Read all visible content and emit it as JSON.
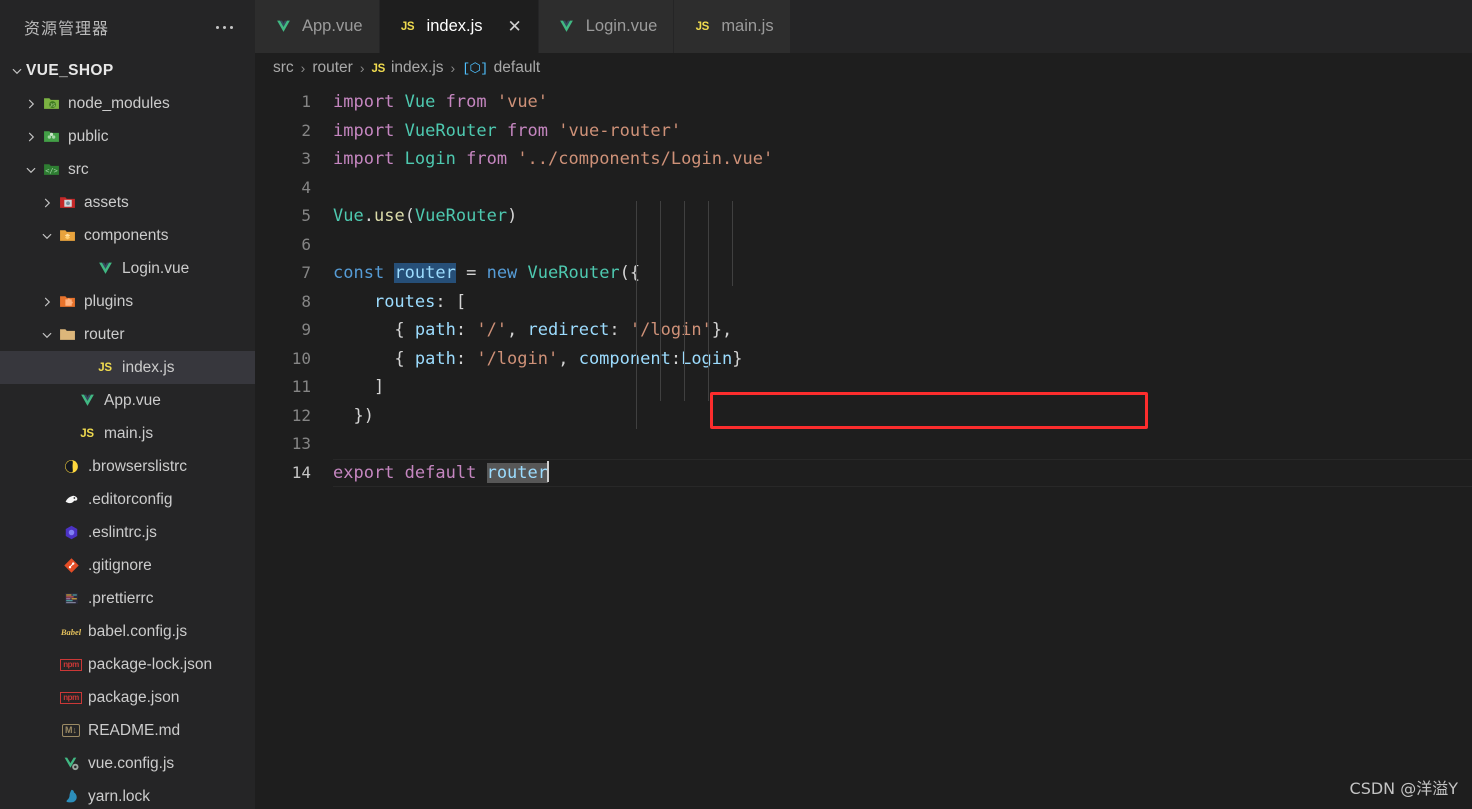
{
  "sidebar": {
    "title": "资源管理器",
    "more_actions": "...",
    "root": {
      "label": "VUE_SHOP",
      "expanded": true
    },
    "items": [
      {
        "label": "node_modules",
        "icon": "nodejs-folder-icon",
        "kind": "folder",
        "indent": 1,
        "twisty": "collapsed"
      },
      {
        "label": "public",
        "icon": "public-folder-icon",
        "kind": "folder",
        "indent": 1,
        "twisty": "collapsed"
      },
      {
        "label": "src",
        "icon": "src-folder-icon",
        "kind": "folder",
        "indent": 1,
        "twisty": "expanded"
      },
      {
        "label": "assets",
        "icon": "assets-folder-icon",
        "kind": "folder",
        "indent": 2,
        "twisty": "collapsed"
      },
      {
        "label": "components",
        "icon": "components-folder-icon",
        "kind": "folder",
        "indent": 2,
        "twisty": "expanded"
      },
      {
        "label": "Login.vue",
        "icon": "vue-icon",
        "kind": "file",
        "indent": 3,
        "twisty": "none"
      },
      {
        "label": "plugins",
        "icon": "plugins-folder-icon",
        "kind": "folder",
        "indent": 2,
        "twisty": "collapsed"
      },
      {
        "label": "router",
        "icon": "router-folder-icon",
        "kind": "folder",
        "indent": 2,
        "twisty": "expanded"
      },
      {
        "label": "index.js",
        "icon": "js-icon",
        "kind": "file",
        "indent": 3,
        "twisty": "none",
        "selected": true
      },
      {
        "label": "App.vue",
        "icon": "vue-icon",
        "kind": "file",
        "indent": 2,
        "twisty": "none"
      },
      {
        "label": "main.js",
        "icon": "js-icon",
        "kind": "file",
        "indent": 2,
        "twisty": "none"
      },
      {
        "label": ".browserslistrc",
        "icon": "browserslist-icon",
        "kind": "file",
        "indent": 1,
        "twisty": "none"
      },
      {
        "label": ".editorconfig",
        "icon": "editorconfig-icon",
        "kind": "file",
        "indent": 1,
        "twisty": "none"
      },
      {
        "label": ".eslintrc.js",
        "icon": "eslint-icon",
        "kind": "file",
        "indent": 1,
        "twisty": "none"
      },
      {
        "label": ".gitignore",
        "icon": "git-icon",
        "kind": "file",
        "indent": 1,
        "twisty": "none"
      },
      {
        "label": ".prettierrc",
        "icon": "prettier-icon",
        "kind": "file",
        "indent": 1,
        "twisty": "none"
      },
      {
        "label": "babel.config.js",
        "icon": "babel-icon",
        "kind": "file",
        "indent": 1,
        "twisty": "none"
      },
      {
        "label": "package-lock.json",
        "icon": "npm-icon",
        "kind": "file",
        "indent": 1,
        "twisty": "none"
      },
      {
        "label": "package.json",
        "icon": "npm-icon",
        "kind": "file",
        "indent": 1,
        "twisty": "none"
      },
      {
        "label": "README.md",
        "icon": "markdown-icon",
        "kind": "file",
        "indent": 1,
        "twisty": "none"
      },
      {
        "label": "vue.config.js",
        "icon": "vue-config-icon",
        "kind": "file",
        "indent": 1,
        "twisty": "none"
      },
      {
        "label": "yarn.lock",
        "icon": "yarn-icon",
        "kind": "file",
        "indent": 1,
        "twisty": "none"
      }
    ]
  },
  "tabs": [
    {
      "label": "App.vue",
      "icon": "vue-icon",
      "active": false,
      "closable": false
    },
    {
      "label": "index.js",
      "icon": "js-icon",
      "active": true,
      "closable": true,
      "close_glyph": "✕"
    },
    {
      "label": "Login.vue",
      "icon": "vue-icon",
      "active": false,
      "closable": false
    },
    {
      "label": "main.js",
      "icon": "js-icon",
      "active": false,
      "closable": false
    }
  ],
  "breadcrumb": [
    {
      "label": "src",
      "icon": null
    },
    {
      "label": "router",
      "icon": null
    },
    {
      "label": "index.js",
      "icon": "js-badge"
    },
    {
      "label": "default",
      "icon": "symbol-object-icon"
    }
  ],
  "breadcrumb_separator": "›",
  "editor": {
    "filename": "index.js",
    "language": "javascript",
    "active_line": 14,
    "cursor_line": 14,
    "lines": [
      {
        "n": 1,
        "tokens": [
          {
            "t": "import",
            "c": "kw"
          },
          {
            "t": " ",
            "c": "pln"
          },
          {
            "t": "Vue",
            "c": "id"
          },
          {
            "t": " ",
            "c": "pln"
          },
          {
            "t": "from",
            "c": "kw"
          },
          {
            "t": " ",
            "c": "pln"
          },
          {
            "t": "'vue'",
            "c": "str"
          }
        ]
      },
      {
        "n": 2,
        "tokens": [
          {
            "t": "import",
            "c": "kw"
          },
          {
            "t": " ",
            "c": "pln"
          },
          {
            "t": "VueRouter",
            "c": "id"
          },
          {
            "t": " ",
            "c": "pln"
          },
          {
            "t": "from",
            "c": "kw"
          },
          {
            "t": " ",
            "c": "pln"
          },
          {
            "t": "'vue-router'",
            "c": "str"
          }
        ]
      },
      {
        "n": 3,
        "tokens": [
          {
            "t": "import",
            "c": "kw"
          },
          {
            "t": " ",
            "c": "pln"
          },
          {
            "t": "Login",
            "c": "id"
          },
          {
            "t": " ",
            "c": "pln"
          },
          {
            "t": "from",
            "c": "kw"
          },
          {
            "t": " ",
            "c": "pln"
          },
          {
            "t": "'../components/Login.vue'",
            "c": "str"
          }
        ]
      },
      {
        "n": 4,
        "tokens": []
      },
      {
        "n": 5,
        "tokens": [
          {
            "t": "Vue",
            "c": "id"
          },
          {
            "t": ".",
            "c": "pln"
          },
          {
            "t": "use",
            "c": "fn"
          },
          {
            "t": "(",
            "c": "pln"
          },
          {
            "t": "VueRouter",
            "c": "id"
          },
          {
            "t": ")",
            "c": "pln"
          }
        ]
      },
      {
        "n": 6,
        "tokens": []
      },
      {
        "n": 7,
        "tokens": [
          {
            "t": "const",
            "c": "ctl"
          },
          {
            "t": " ",
            "c": "pln"
          },
          {
            "t": "router",
            "c": "var",
            "hl": "blue"
          },
          {
            "t": " = ",
            "c": "pln"
          },
          {
            "t": "new",
            "c": "ctl"
          },
          {
            "t": " ",
            "c": "pln"
          },
          {
            "t": "VueRouter",
            "c": "id"
          },
          {
            "t": "({",
            "c": "pln"
          }
        ]
      },
      {
        "n": 8,
        "tokens": [
          {
            "t": "    ",
            "c": "pln"
          },
          {
            "t": "routes",
            "c": "prop"
          },
          {
            "t": ": [",
            "c": "pln"
          }
        ]
      },
      {
        "n": 9,
        "tokens": [
          {
            "t": "      { ",
            "c": "pln"
          },
          {
            "t": "path",
            "c": "prop"
          },
          {
            "t": ": ",
            "c": "pln"
          },
          {
            "t": "'/'",
            "c": "str"
          },
          {
            "t": ", ",
            "c": "pln"
          },
          {
            "t": "redirect",
            "c": "prop"
          },
          {
            "t": ": ",
            "c": "pln"
          },
          {
            "t": "'/login'",
            "c": "str"
          },
          {
            "t": "},",
            "c": "pln"
          }
        ],
        "boxed": true
      },
      {
        "n": 10,
        "tokens": [
          {
            "t": "      { ",
            "c": "pln"
          },
          {
            "t": "path",
            "c": "prop"
          },
          {
            "t": ": ",
            "c": "pln"
          },
          {
            "t": "'/login'",
            "c": "str"
          },
          {
            "t": ", ",
            "c": "pln"
          },
          {
            "t": "component",
            "c": "prop"
          },
          {
            "t": ":",
            "c": "pln"
          },
          {
            "t": "Login",
            "c": "prop"
          },
          {
            "t": "}",
            "c": "pln"
          }
        ]
      },
      {
        "n": 11,
        "tokens": [
          {
            "t": "    ]",
            "c": "pln"
          }
        ]
      },
      {
        "n": 12,
        "tokens": [
          {
            "t": "  })",
            "c": "pln"
          }
        ]
      },
      {
        "n": 13,
        "tokens": []
      },
      {
        "n": 14,
        "tokens": [
          {
            "t": "export",
            "c": "kw"
          },
          {
            "t": " ",
            "c": "pln"
          },
          {
            "t": "default",
            "c": "kw"
          },
          {
            "t": " ",
            "c": "pln"
          },
          {
            "t": "router",
            "c": "var",
            "hl": "gray",
            "cursor": true
          }
        ],
        "active": true
      }
    ],
    "annotation": {
      "type": "red-rectangle",
      "target_line": 9,
      "color": "#fc2d2d"
    }
  },
  "watermark": "CSDN @洋溢Y",
  "colors": {
    "sidebar_bg": "#252526",
    "editor_bg": "#1e1e1e",
    "tab_inactive_bg": "#2d2d2d",
    "tab_active_bg": "#1e1e1e",
    "selection_blue": "#264f78",
    "selection_gray": "#575757",
    "annotation_red": "#fc2d2d",
    "line_number": "#858585"
  }
}
